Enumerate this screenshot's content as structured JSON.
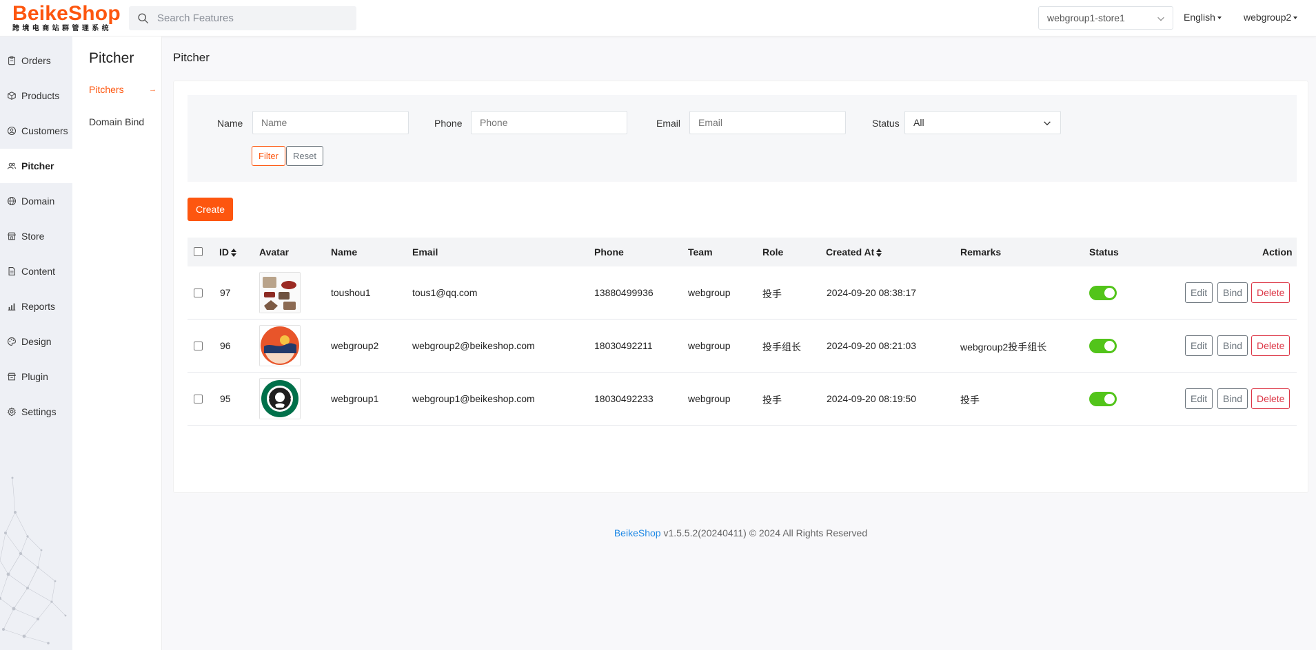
{
  "header": {
    "logo_text": "BeikeShop",
    "logo_tagline": "跨境电商站群管理系统",
    "search_placeholder": "Search Features",
    "store_select": "webgroup1-store1",
    "language": "English",
    "user": "webgroup2"
  },
  "sidebar": {
    "items": [
      {
        "label": "Orders",
        "icon": "clipboard-icon"
      },
      {
        "label": "Products",
        "icon": "box-icon"
      },
      {
        "label": "Customers",
        "icon": "user-circle-icon"
      },
      {
        "label": "Pitcher",
        "icon": "users-icon",
        "active": true
      },
      {
        "label": "Domain",
        "icon": "globe-icon"
      },
      {
        "label": "Store",
        "icon": "store-icon"
      },
      {
        "label": "Content",
        "icon": "file-text-icon"
      },
      {
        "label": "Reports",
        "icon": "bar-chart-icon"
      },
      {
        "label": "Design",
        "icon": "palette-icon"
      },
      {
        "label": "Plugin",
        "icon": "plug-icon"
      },
      {
        "label": "Settings",
        "icon": "gear-icon"
      }
    ]
  },
  "submenu": {
    "title": "Pitcher",
    "items": [
      "Pitchers",
      "Domain Bind"
    ]
  },
  "page": {
    "title": "Pitcher"
  },
  "filter": {
    "name_label": "Name",
    "name_placeholder": "Name",
    "phone_label": "Phone",
    "phone_placeholder": "Phone",
    "email_label": "Email",
    "email_placeholder": "Email",
    "status_label": "Status",
    "status_value": "All",
    "filter_button": "Filter",
    "reset_button": "Reset"
  },
  "create_button": "Create",
  "table": {
    "columns": [
      "ID",
      "Avatar",
      "Name",
      "Email",
      "Phone",
      "Team",
      "Role",
      "Created At",
      "Remarks",
      "Status",
      "Action"
    ],
    "rows": [
      {
        "id": "97",
        "name": "toushou1",
        "email": "tous1@qq.com",
        "phone": "13880499936",
        "team": "webgroup",
        "role": "投手",
        "created_at": "2024-09-20 08:38:17",
        "remarks": "",
        "status": true
      },
      {
        "id": "96",
        "name": "webgroup2",
        "email": "webgroup2@beikeshop.com",
        "phone": "18030492211",
        "team": "webgroup",
        "role": "投手组长",
        "created_at": "2024-09-20 08:21:03",
        "remarks": "webgroup2投手组长",
        "status": true
      },
      {
        "id": "95",
        "name": "webgroup1",
        "email": "webgroup1@beikeshop.com",
        "phone": "18030492233",
        "team": "webgroup",
        "role": "投手",
        "created_at": "2024-09-20 08:19:50",
        "remarks": "投手",
        "status": true
      }
    ],
    "actions": {
      "edit": "Edit",
      "bind": "Bind",
      "delete": "Delete"
    }
  },
  "footer": {
    "brand": "BeikeShop",
    "text": " v1.5.5.2(20240411) © 2024 All Rights Reserved"
  },
  "colors": {
    "accent": "#fd560f",
    "toggle_on": "#52c41a",
    "danger": "#dc3545",
    "link": "#1e88e5"
  }
}
